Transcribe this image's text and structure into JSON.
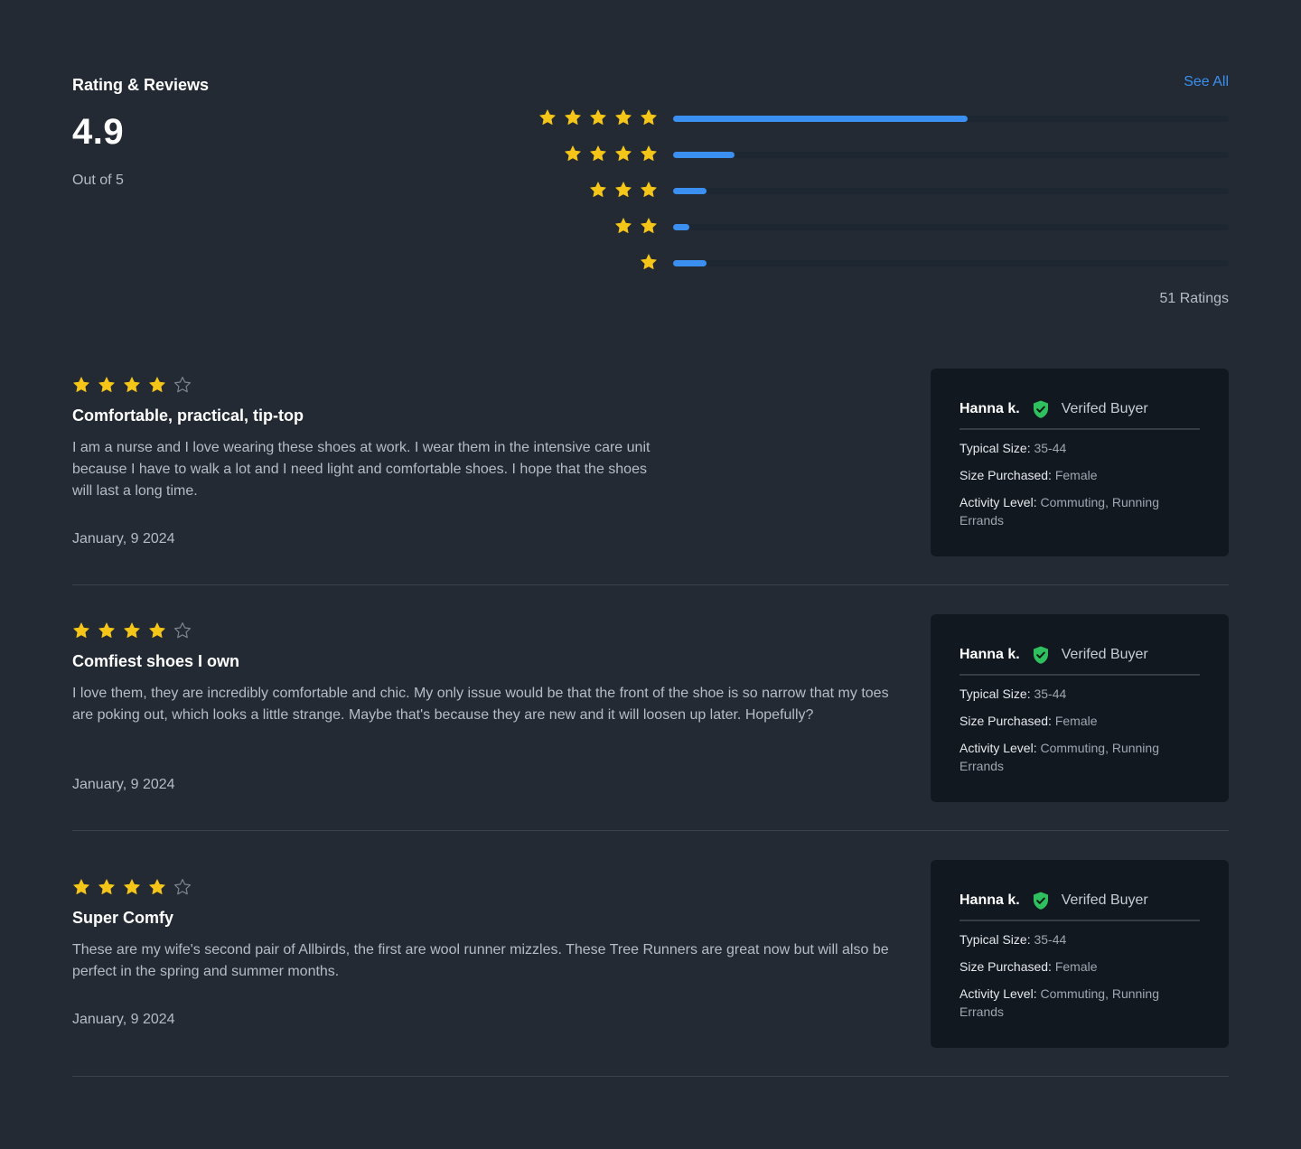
{
  "summary": {
    "title": "Rating & Reviews",
    "see_all": "See All",
    "average": "4.9",
    "out_of": "Out of 5",
    "ratings_count": "51 Ratings",
    "distribution": [
      {
        "stars": 5,
        "fraction": 0.53
      },
      {
        "stars": 4,
        "fraction": 0.11
      },
      {
        "stars": 3,
        "fraction": 0.06
      },
      {
        "stars": 2,
        "fraction": 0.03
      },
      {
        "stars": 1,
        "fraction": 0.06
      }
    ]
  },
  "colors": {
    "star_filled": "#f5c518",
    "star_empty": "#7d858f",
    "accent": "#3b8ff0",
    "verified": "#2fbf5f"
  },
  "reviews": [
    {
      "rating": 4,
      "title": "Comfortable, practical, tip-top",
      "body": "I am a nurse and I love wearing these shoes at work. I wear them in the intensive care unit because I have to walk a lot and I need light and comfortable shoes. I hope that the shoes will last a long time.",
      "date": "January, 9 2024",
      "reviewer": {
        "name": "Hanna k.",
        "badge": "Verifed Buyer",
        "typical_size_label": "Typical Size:",
        "typical_size": "35-44",
        "size_purchased_label": "Size Purchased:",
        "size_purchased": "Female",
        "activity_label": "Activity Level:",
        "activity": "Commuting, Running Errands"
      }
    },
    {
      "rating": 4,
      "title": "Comfiest shoes I own",
      "body": "I love them, they are incredibly comfortable and chic. My only issue would be that the front of the shoe is so narrow that my toes are poking out, which looks a little strange. Maybe that's because they are new and it will loosen up later. Hopefully?",
      "date": "January, 9 2024",
      "reviewer": {
        "name": "Hanna k.",
        "badge": "Verifed Buyer",
        "typical_size_label": "Typical Size:",
        "typical_size": "35-44",
        "size_purchased_label": "Size Purchased:",
        "size_purchased": "Female",
        "activity_label": "Activity Level:",
        "activity": "Commuting, Running Errands"
      }
    },
    {
      "rating": 4,
      "title": "Super Comfy",
      "body": "These are my wife's second pair of Allbirds, the first are wool runner mizzles. These Tree Runners are great now but will also be perfect in the spring and summer months.",
      "date": "January, 9 2024",
      "reviewer": {
        "name": "Hanna k.",
        "badge": "Verifed Buyer",
        "typical_size_label": "Typical Size:",
        "typical_size": "35-44",
        "size_purchased_label": "Size Purchased:",
        "size_purchased": "Female",
        "activity_label": "Activity Level:",
        "activity": "Commuting, Running Errands"
      }
    }
  ]
}
